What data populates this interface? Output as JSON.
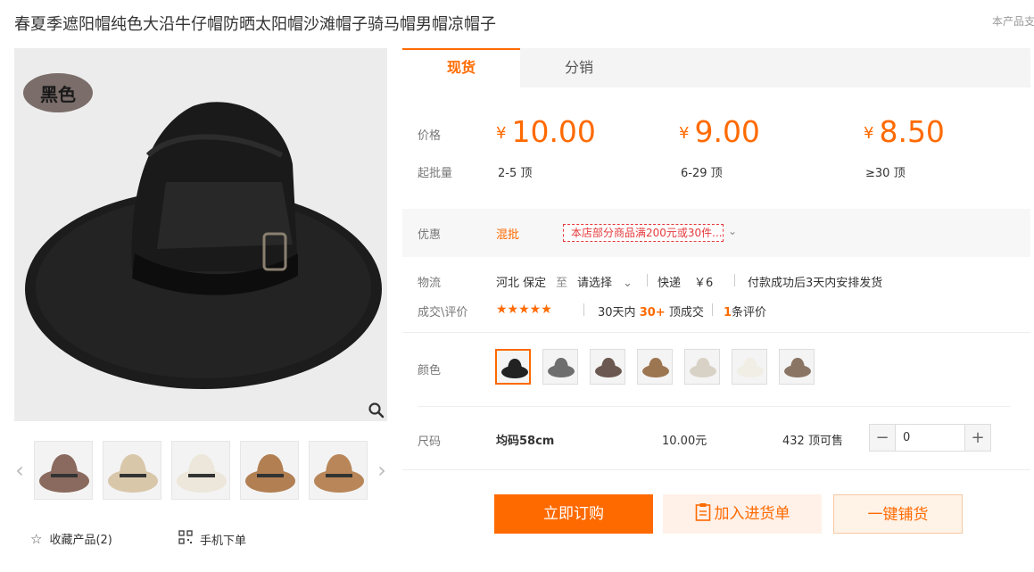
{
  "product": {
    "title": "春夏季遮阳帽纯色大沿牛仔帽防晒太阳帽沙滩帽子骑马帽男帽凉帽子",
    "notice": "本产品支",
    "color_tag": "黑色"
  },
  "gallery": {
    "thumbnails": [
      {
        "color": "#8a6a5e"
      },
      {
        "color": "#d9c7aa"
      },
      {
        "color": "#ece7da"
      },
      {
        "color": "#b27f52"
      },
      {
        "color": "#b88658"
      }
    ]
  },
  "actions": {
    "favorite": "收藏产品(2)",
    "mobile_order": "手机下单"
  },
  "tabs": [
    {
      "label": "现货",
      "active": true
    },
    {
      "label": "分销",
      "active": false
    }
  ],
  "pricing": {
    "price_label": "价格",
    "moq_label": "起批量",
    "currency": "¥",
    "tiers": [
      {
        "price": "10.00",
        "range": "2-5 顶"
      },
      {
        "price": "9.00",
        "range": "6-29 顶"
      },
      {
        "price": "8.50",
        "range": "≥30 顶"
      }
    ]
  },
  "promotion": {
    "label": "优惠",
    "type": "混批",
    "text": "本店部分商品满200元或30件...",
    "chevron": "⌄"
  },
  "logistics": {
    "label": "物流",
    "origin": "河北 保定",
    "to": "至",
    "destination": "请选择",
    "express": "快递",
    "fee": "￥6",
    "ship_note": "付款成功后3天内安排发货"
  },
  "reviews": {
    "label": "成交\\评价",
    "stars": "★★★★★",
    "deal_prefix": "30天内",
    "deal_count": "30+",
    "deal_suffix": "顶成交",
    "review_count": "1",
    "review_suffix": "条评价"
  },
  "colors": {
    "label": "颜色",
    "swatches": [
      {
        "color": "#222222",
        "selected": true
      },
      {
        "color": "#6e6e6e",
        "selected": false
      },
      {
        "color": "#6b5850",
        "selected": false
      },
      {
        "color": "#9c7551",
        "selected": false
      },
      {
        "color": "#d8d2c6",
        "selected": false
      },
      {
        "color": "#f1eee6",
        "selected": false
      },
      {
        "color": "#8a7565",
        "selected": false
      }
    ]
  },
  "size": {
    "label": "尺码",
    "name": "均码58cm",
    "price": "10.00元",
    "stock": "432 顶可售",
    "quantity": "0",
    "minus": "−",
    "plus": "+"
  },
  "buttons": {
    "buy": "立即订购",
    "cart": "加入进货单",
    "distribute": "一键铺货"
  },
  "theme": {
    "accent": "#ff6a00"
  }
}
